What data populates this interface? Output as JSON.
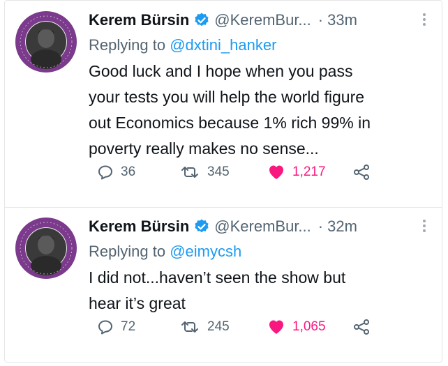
{
  "tweets": [
    {
      "author_name": "Kerem Bürsin",
      "handle": "@KeremBur...",
      "separator": "·",
      "time": "33m",
      "replying_prefix": "Replying to",
      "replying_to": "@dxtini_hanker",
      "text_lines": [
        "Good luck and I hope when you pass",
        "your tests you will help the world figure",
        "out Economics because 1% rich 99% in",
        "poverty really makes no sense..."
      ],
      "replies": "36",
      "retweets": "345",
      "likes": "1,217"
    },
    {
      "author_name": "Kerem Bürsin",
      "handle": "@KeremBur...",
      "separator": "·",
      "time": "32m",
      "replying_prefix": "Replying to",
      "replying_to": "@eimycsh",
      "text_lines": [
        "I did not...haven’t seen the show but",
        "hear it’s great"
      ],
      "replies": "72",
      "retweets": "245",
      "likes": "1,065"
    }
  ],
  "colors": {
    "verified": "#1d9bf0",
    "mention": "#1d9bf0",
    "like": "#f91880",
    "avatar_ring": "#7b3a8c"
  },
  "icons": [
    "verified-badge-icon",
    "more-options-icon",
    "reply-icon",
    "retweet-icon",
    "heart-icon",
    "share-icon"
  ]
}
